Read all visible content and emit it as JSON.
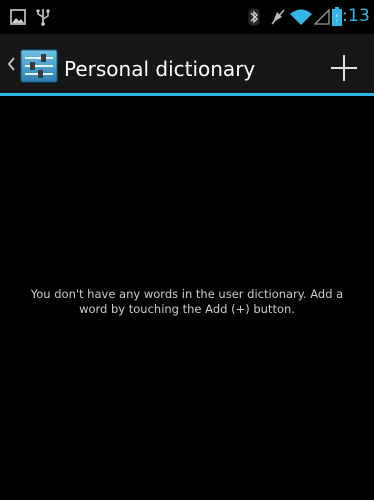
{
  "status_bar": {
    "time": "4:13",
    "icons": [
      "picture-notification-icon",
      "usb-icon",
      "bluetooth-icon",
      "vibrate-icon",
      "wifi-icon",
      "signal-icon",
      "battery-icon"
    ]
  },
  "action_bar": {
    "title": "Personal dictionary",
    "up_icon": "back-caret-icon",
    "app_icon": "settings-icon",
    "add_icon": "plus-icon"
  },
  "main": {
    "empty_message": "You don't have any words in the user dictionary. Add a word by touching the Add (+) button."
  },
  "colors": {
    "accent": "#33b5e5",
    "background": "#000000",
    "action_bar": "#161616"
  }
}
